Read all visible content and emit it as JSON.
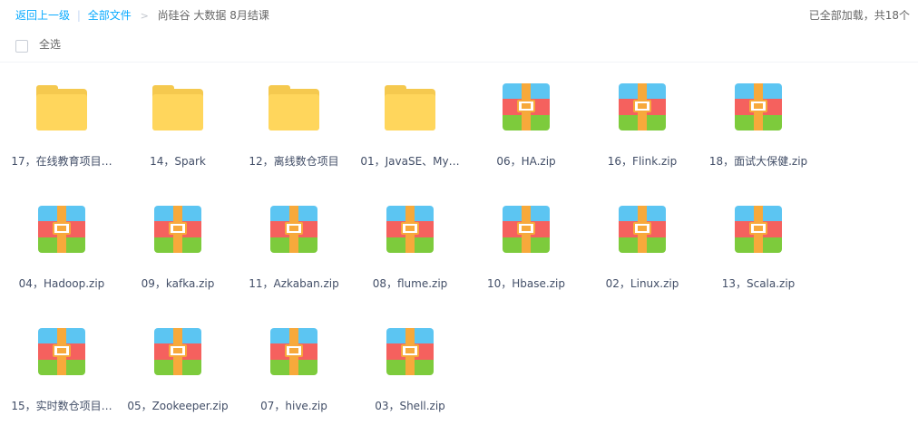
{
  "breadcrumb": {
    "back": "返回上一级",
    "separator": "|",
    "all_files": "全部文件",
    "arrow": ">",
    "current": "尚硅谷 大数据 8月结课"
  },
  "load_status": "已全部加载，共18个",
  "select_all": "全选",
  "files": [
    {
      "name": "17，在线教育项目…",
      "type": "folder"
    },
    {
      "name": "14，Spark",
      "type": "folder"
    },
    {
      "name": "12，离线数仓项目",
      "type": "folder"
    },
    {
      "name": "01，JavaSE、My…",
      "type": "folder"
    },
    {
      "name": "06，HA.zip",
      "type": "zip"
    },
    {
      "name": "16，Flink.zip",
      "type": "zip"
    },
    {
      "name": "18，面试大保健.zip",
      "type": "zip"
    },
    {
      "name": "04，Hadoop.zip",
      "type": "zip"
    },
    {
      "name": "09，kafka.zip",
      "type": "zip"
    },
    {
      "name": "11，Azkaban.zip",
      "type": "zip"
    },
    {
      "name": "08，flume.zip",
      "type": "zip"
    },
    {
      "name": "10，Hbase.zip",
      "type": "zip"
    },
    {
      "name": "02，Linux.zip",
      "type": "zip"
    },
    {
      "name": "13，Scala.zip",
      "type": "zip"
    },
    {
      "name": "15，实时数仓项目…",
      "type": "zip"
    },
    {
      "name": "05，Zookeeper.zip",
      "type": "zip"
    },
    {
      "name": "07，hive.zip",
      "type": "zip"
    },
    {
      "name": "03，Shell.zip",
      "type": "zip"
    }
  ]
}
